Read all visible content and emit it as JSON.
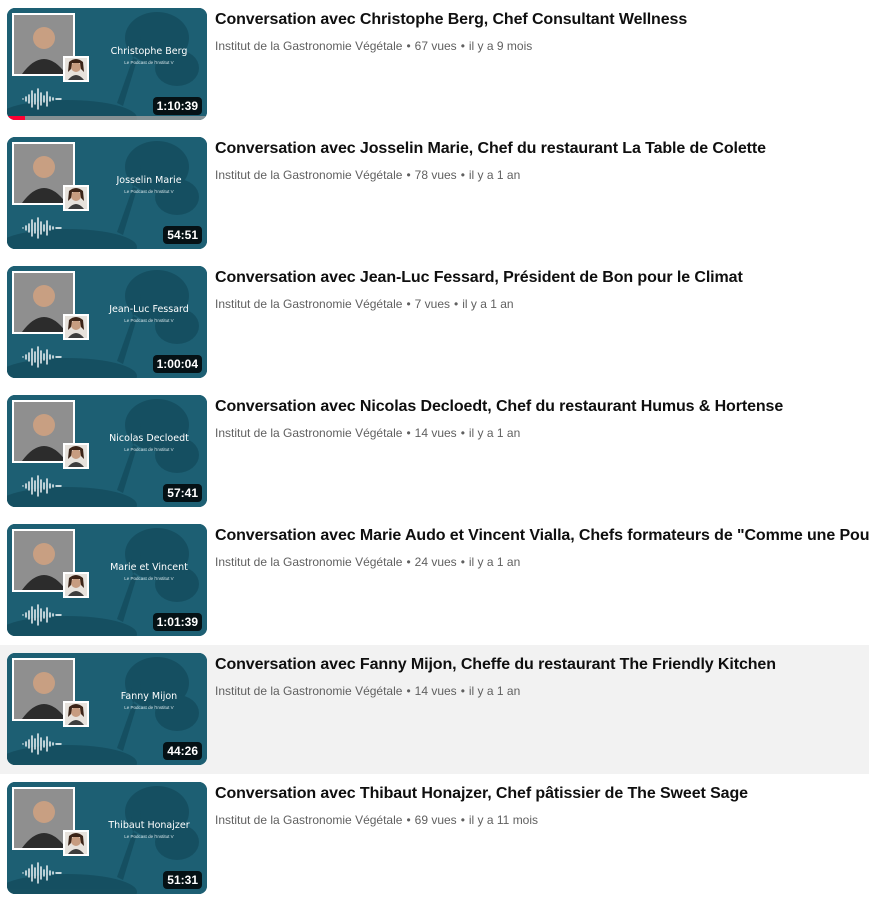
{
  "videos": [
    {
      "title": "Conversation avec Christophe Berg, Chef Consultant Wellness",
      "channel": "Institut de la Gastronomie Végétale",
      "views": "67 vues",
      "age": "il y a 9 mois",
      "duration": "1:10:39",
      "thumb_name": "Christophe Berg",
      "watched_fraction": 0.09
    },
    {
      "title": "Conversation avec Josselin Marie, Chef du restaurant La Table de Colette",
      "channel": "Institut de la Gastronomie Végétale",
      "views": "78 vues",
      "age": "il y a 1 an",
      "duration": "54:51",
      "thumb_name": "Josselin Marie"
    },
    {
      "title": "Conversation avec Jean-Luc Fessard, Président de Bon pour le Climat",
      "channel": "Institut de la Gastronomie Végétale",
      "views": "7 vues",
      "age": "il y a 1 an",
      "duration": "1:00:04",
      "thumb_name": "Jean-Luc Fessard"
    },
    {
      "title": "Conversation avec Nicolas Decloedt, Chef du restaurant Humus & Hortense",
      "channel": "Institut de la Gastronomie Végétale",
      "views": "14 vues",
      "age": "il y a 1 an",
      "duration": "57:41",
      "thumb_name": "Nicolas Decloedt"
    },
    {
      "title": "Conversation avec Marie Audo et Vincent Vialla, Chefs formateurs de \"Comme une Poule\"",
      "channel": "Institut de la Gastronomie Végétale",
      "views": "24 vues",
      "age": "il y a 1 an",
      "duration": "1:01:39",
      "thumb_name": "Marie et Vincent"
    },
    {
      "title": "Conversation avec Fanny Mijon, Cheffe du restaurant The Friendly Kitchen",
      "channel": "Institut de la Gastronomie Végétale",
      "views": "14 vues",
      "age": "il y a 1 an",
      "duration": "44:26",
      "thumb_name": "Fanny Mijon",
      "hovered": true
    },
    {
      "title": "Conversation avec Thibaut Honajzer, Chef pâtissier de The Sweet Sage",
      "channel": "Institut de la Gastronomie Végétale",
      "views": "69 vues",
      "age": "il y a 11 mois",
      "duration": "51:31",
      "thumb_name": "Thibaut Honajzer"
    }
  ],
  "thumb_subtitle": "Le Podcast de l'Institut V",
  "colors": {
    "thumb_bg": "#1d5f73",
    "progress": "#ff0033",
    "hover_bg": "#f2f2f2"
  }
}
